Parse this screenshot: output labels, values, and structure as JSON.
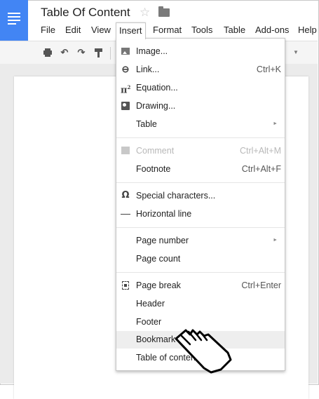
{
  "doc": {
    "title": "Table Of Content"
  },
  "menubar": {
    "items": [
      {
        "label": "File"
      },
      {
        "label": "Edit"
      },
      {
        "label": "View"
      },
      {
        "label": "Insert"
      },
      {
        "label": "Format"
      },
      {
        "label": "Tools"
      },
      {
        "label": "Table"
      },
      {
        "label": "Add-ons"
      },
      {
        "label": "Help"
      }
    ],
    "active": "Insert"
  },
  "insert_menu": {
    "items": [
      {
        "label": "Image...",
        "icon": "image-icon"
      },
      {
        "label": "Link...",
        "shortcut": "Ctrl+K",
        "icon": "link-icon"
      },
      {
        "label": "Equation...",
        "icon": "equation-icon"
      },
      {
        "label": "Drawing...",
        "icon": "drawing-icon"
      },
      {
        "label": "Table",
        "submenu": true
      },
      {
        "label": "Comment",
        "shortcut": "Ctrl+Alt+M",
        "icon": "comment-icon",
        "disabled": true
      },
      {
        "label": "Footnote",
        "shortcut": "Ctrl+Alt+F"
      },
      {
        "label": "Special characters...",
        "icon": "omega-icon"
      },
      {
        "label": "Horizontal line",
        "icon": "horizontal-line-icon"
      },
      {
        "label": "Page number",
        "submenu": true
      },
      {
        "label": "Page count"
      },
      {
        "label": "Page break",
        "shortcut": "Ctrl+Enter",
        "icon": "page-break-icon"
      },
      {
        "label": "Header"
      },
      {
        "label": "Footer"
      },
      {
        "label": "Bookmark",
        "hovered": true
      },
      {
        "label": "Table of contents"
      }
    ]
  },
  "toolbar": {
    "icons": [
      "print-icon",
      "undo-icon",
      "redo-icon",
      "paint-format-icon"
    ]
  },
  "colors": {
    "brand": "#4285f4",
    "menu_hover": "#eeeeee",
    "disabled_text": "#b8b8b8"
  }
}
